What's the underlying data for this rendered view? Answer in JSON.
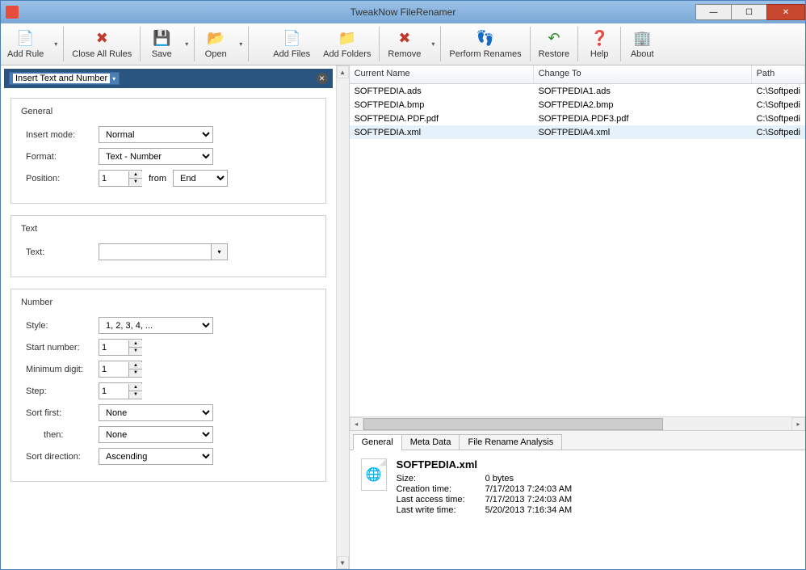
{
  "title": "TweakNow FileRenamer",
  "toolbar": {
    "left": [
      {
        "icon": "📄",
        "label": "Add Rule",
        "arrow": true
      },
      {
        "icon": "✖",
        "label": "Close All Rules",
        "arrow": false,
        "color": "#c0392b"
      },
      {
        "icon": "💾",
        "label": "Save",
        "arrow": true,
        "color": "#2a5fa5"
      },
      {
        "icon": "📂",
        "label": "Open",
        "arrow": true,
        "color": "#2a8a2a"
      }
    ],
    "right": [
      {
        "icon": "📄",
        "label": "Add Files",
        "arrow": false
      },
      {
        "icon": "📁",
        "label": "Add Folders",
        "arrow": false,
        "color": "#d4a017"
      },
      {
        "icon": "✖",
        "label": "Remove",
        "arrow": true,
        "color": "#c0392b"
      },
      {
        "icon": "👣",
        "label": "Perform Renames",
        "arrow": false,
        "color": "#c0392b"
      },
      {
        "icon": "↶",
        "label": "Restore",
        "arrow": false,
        "color": "#2a8a2a"
      },
      {
        "icon": "❓",
        "label": "Help",
        "arrow": false,
        "color": "#2a5fa5"
      },
      {
        "icon": "🏢",
        "label": "About",
        "arrow": false
      }
    ]
  },
  "rule": {
    "title": "Insert Text and Number",
    "general": {
      "legend": "General",
      "insert_mode_lbl": "Insert mode:",
      "insert_mode_val": "Normal",
      "format_lbl": "Format:",
      "format_val": "Text - Number",
      "position_lbl": "Position:",
      "position_val": "1",
      "from_lbl": "from",
      "from_val": "End"
    },
    "text": {
      "legend": "Text",
      "text_lbl": "Text:",
      "text_val": ""
    },
    "number": {
      "legend": "Number",
      "style_lbl": "Style:",
      "style_val": "1, 2, 3, 4, ...",
      "start_lbl": "Start number:",
      "start_val": "1",
      "mindigit_lbl": "Minimum digit:",
      "mindigit_val": "1",
      "step_lbl": "Step:",
      "step_val": "1",
      "sortfirst_lbl": "Sort first:",
      "sortfirst_val": "None",
      "then_lbl": "then:",
      "then_val": "None",
      "sortdir_lbl": "Sort direction:",
      "sortdir_val": "Ascending"
    }
  },
  "filelist": {
    "cols": [
      "Current Name",
      "Change To",
      "Path"
    ],
    "rows": [
      {
        "cur": "SOFTPEDIA.ads",
        "to": "SOFTPEDIA1.ads",
        "path": "C:\\Softpedi"
      },
      {
        "cur": "SOFTPEDIA.bmp",
        "to": "SOFTPEDIA2.bmp",
        "path": "C:\\Softpedi"
      },
      {
        "cur": "SOFTPEDIA.PDF.pdf",
        "to": "SOFTPEDIA.PDF3.pdf",
        "path": "C:\\Softpedi"
      },
      {
        "cur": "SOFTPEDIA.xml",
        "to": "SOFTPEDIA4.xml",
        "path": "C:\\Softpedi",
        "sel": true
      }
    ]
  },
  "tabs": [
    "General",
    "Meta Data",
    "File Rename Analysis"
  ],
  "fileinfo": {
    "name": "SOFTPEDIA.xml",
    "rows": [
      {
        "l": "Size:",
        "v": "0 bytes"
      },
      {
        "l": "Creation time:",
        "v": "7/17/2013 7:24:03 AM"
      },
      {
        "l": "Last access time:",
        "v": "7/17/2013 7:24:03 AM"
      },
      {
        "l": "Last write time:",
        "v": "5/20/2013 7:16:34 AM"
      }
    ]
  }
}
